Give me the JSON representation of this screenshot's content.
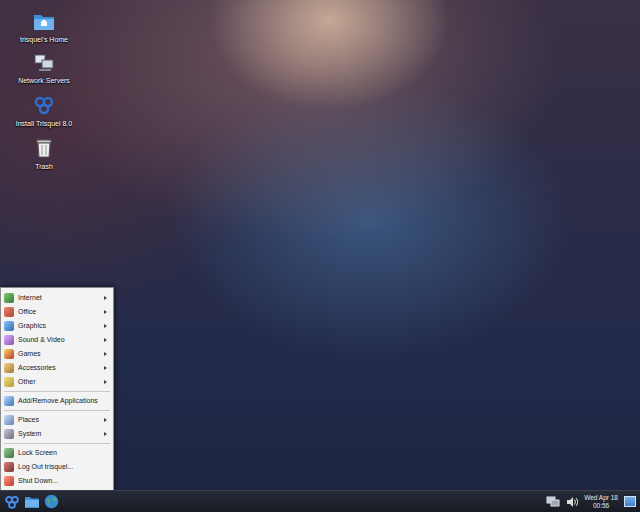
{
  "desktop": {
    "icons": [
      {
        "label": "trisquel's Home"
      },
      {
        "label": "Network Servers"
      },
      {
        "label": "Install Trisquel 8.0"
      },
      {
        "label": "Trash"
      }
    ]
  },
  "menu": {
    "open": true,
    "groups": [
      [
        {
          "label": "Internet",
          "submenu": true
        },
        {
          "label": "Office",
          "submenu": true
        },
        {
          "label": "Graphics",
          "submenu": true
        },
        {
          "label": "Sound & Video",
          "submenu": true
        },
        {
          "label": "Games",
          "submenu": true
        },
        {
          "label": "Accessories",
          "submenu": true
        },
        {
          "label": "Other",
          "submenu": true
        }
      ],
      [
        {
          "label": "Add/Remove Applications",
          "submenu": false
        }
      ],
      [
        {
          "label": "Places",
          "submenu": true
        },
        {
          "label": "System",
          "submenu": true
        }
      ],
      [
        {
          "label": "Lock Screen",
          "submenu": false
        },
        {
          "label": "Log Out trisquel...",
          "submenu": false
        },
        {
          "label": "Shut Down...",
          "submenu": false
        }
      ]
    ]
  },
  "taskbar": {
    "clock": {
      "date": "Wed Apr 18",
      "time": "00:56"
    }
  }
}
